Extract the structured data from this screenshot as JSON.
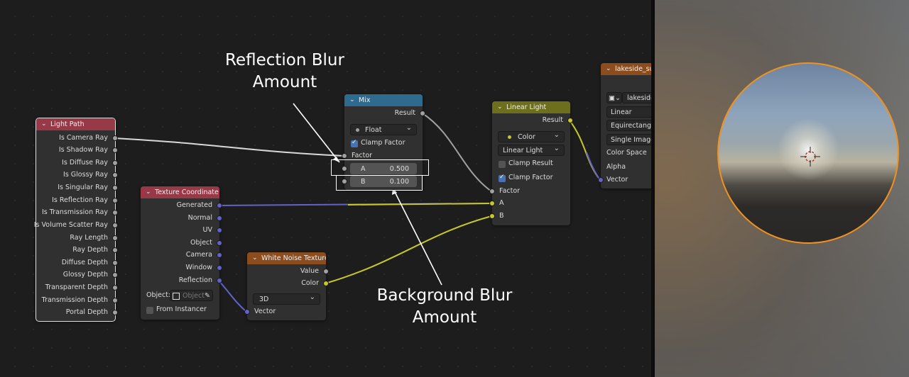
{
  "colors": {
    "editor_bg": "#1d1d1d",
    "node_body": "#303030",
    "header_input": "#973947",
    "header_texture": "#8b4d1e",
    "header_converter": "#2f6b8f",
    "header_color": "#6d6f1d",
    "link_gray": "#a1a1a1",
    "link_purple": "#6363c7",
    "link_yellow": "#c7c729",
    "selection_orange": "#f0921f"
  },
  "annotations": {
    "reflection": {
      "line1": "Reflection Blur",
      "line2": "Amount"
    },
    "background": {
      "line1": "Background Blur",
      "line2": "Amount"
    }
  },
  "light_path": {
    "title": "Light Path",
    "outputs": [
      "Is Camera Ray",
      "Is Shadow Ray",
      "Is Diffuse Ray",
      "Is Glossy Ray",
      "Is Singular Ray",
      "Is Reflection Ray",
      "Is Transmission Ray",
      "Is Volume Scatter Ray",
      "Ray Length",
      "Ray Depth",
      "Diffuse Depth",
      "Glossy Depth",
      "Transparent Depth",
      "Transmission Depth",
      "Portal Depth"
    ]
  },
  "texture_coordinate": {
    "title": "Texture Coordinate",
    "outputs": [
      "Generated",
      "Normal",
      "UV",
      "Object",
      "Camera",
      "Window",
      "Reflection"
    ],
    "object_label": "Object:",
    "object_placeholder": "Object",
    "from_instancer": "From Instancer"
  },
  "white_noise": {
    "title": "White Noise Texture",
    "outputs": [
      "Value",
      "Color"
    ],
    "dimension": "3D",
    "input": "Vector"
  },
  "mix": {
    "title": "Mix",
    "output": "Result",
    "data_type": "Float",
    "clamp_factor": "Clamp Factor",
    "factor": "Factor",
    "a_label": "A",
    "a_value": "0.500",
    "b_label": "B",
    "b_value": "0.100"
  },
  "linear_light": {
    "title": "Linear Light",
    "output": "Result",
    "data_type": "Color",
    "blend_mode": "Linear Light",
    "clamp_result": "Clamp Result",
    "clamp_factor": "Clamp Factor",
    "inputs": [
      "Factor",
      "A",
      "B"
    ]
  },
  "env_texture": {
    "title": "lakeside_sunr",
    "image": "lakeside_",
    "interpolation": "Linear",
    "projection": "Equirectangula",
    "source": "Single Image",
    "color_space": "Color Space",
    "alpha": "Alpha",
    "input": "Vector"
  }
}
